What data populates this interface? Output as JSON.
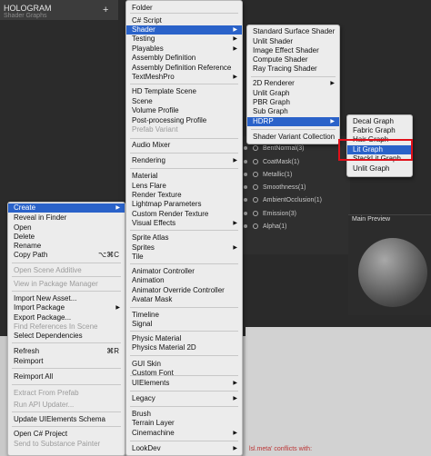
{
  "window": {
    "title": "HOLOGRAM",
    "subtitle": "Shader Graphs",
    "plus": "+"
  },
  "left_menu": {
    "items": [
      {
        "label": "Create",
        "arrow": "▶",
        "selected": true
      },
      {
        "label": "Reveal in Finder"
      },
      {
        "label": "Open"
      },
      {
        "label": "Delete"
      },
      {
        "label": "Rename"
      },
      {
        "label": "Copy Path",
        "shortcut": "⌥⌘C"
      },
      {
        "label": "Open Scene Additive",
        "disabled": true
      },
      {
        "label": "View in Package Manager",
        "disabled": true
      },
      {
        "label": "Import New Asset..."
      },
      {
        "label": "Import Package",
        "arrow": "▶"
      },
      {
        "label": "Export Package..."
      },
      {
        "label": "Find References In Scene",
        "disabled": true
      },
      {
        "label": "Select Dependencies"
      },
      {
        "label": "Refresh",
        "shortcut": "⌘R"
      },
      {
        "label": "Reimport"
      },
      {
        "label": "Reimport All"
      },
      {
        "label": "Extract From Prefab",
        "disabled": true
      },
      {
        "label": "Run API Updater...",
        "disabled": true
      },
      {
        "label": "Update UIElements Schema"
      },
      {
        "label": "Open C# Project"
      },
      {
        "label": "Send to Substance Painter",
        "disabled": true
      }
    ]
  },
  "create_menu": {
    "items": [
      {
        "label": "Folder"
      },
      {
        "label": "C# Script"
      },
      {
        "label": "Shader",
        "arrow": "▶",
        "selected": true
      },
      {
        "label": "Testing",
        "arrow": "▶"
      },
      {
        "label": "Playables",
        "arrow": "▶"
      },
      {
        "label": "Assembly Definition"
      },
      {
        "label": "Assembly Definition Reference"
      },
      {
        "label": "TextMeshPro",
        "arrow": "▶"
      },
      {
        "label": "HD Template Scene"
      },
      {
        "label": "Scene"
      },
      {
        "label": "Volume Profile"
      },
      {
        "label": "Post-processing Profile"
      },
      {
        "label": "Prefab Variant",
        "disabled": true
      },
      {
        "label": "Audio Mixer"
      },
      {
        "label": "Rendering",
        "arrow": "▶"
      },
      {
        "label": "Material"
      },
      {
        "label": "Lens Flare"
      },
      {
        "label": "Render Texture"
      },
      {
        "label": "Lightmap Parameters"
      },
      {
        "label": "Custom Render Texture"
      },
      {
        "label": "Visual Effects",
        "arrow": "▶"
      },
      {
        "label": "Sprite Atlas"
      },
      {
        "label": "Sprites",
        "arrow": "▶"
      },
      {
        "label": "Tile"
      },
      {
        "label": "Animator Controller"
      },
      {
        "label": "Animation"
      },
      {
        "label": "Animator Override Controller"
      },
      {
        "label": "Avatar Mask"
      },
      {
        "label": "Timeline"
      },
      {
        "label": "Signal"
      },
      {
        "label": "Physic Material"
      },
      {
        "label": "Physics Material 2D"
      },
      {
        "label": "GUI Skin"
      },
      {
        "label": "Custom Font"
      },
      {
        "label": "UIElements",
        "arrow": "▶"
      },
      {
        "label": "Legacy",
        "arrow": "▶"
      },
      {
        "label": "Brush"
      },
      {
        "label": "Terrain Layer"
      },
      {
        "label": "Cinemachine",
        "arrow": "▶"
      },
      {
        "label": "LookDev",
        "arrow": "▶"
      }
    ]
  },
  "shader_menu": {
    "items": [
      {
        "label": "Standard Surface Shader"
      },
      {
        "label": "Unlit Shader"
      },
      {
        "label": "Image Effect Shader"
      },
      {
        "label": "Compute Shader"
      },
      {
        "label": "Ray Tracing Shader"
      },
      {
        "label": "2D Renderer",
        "arrow": "▶"
      },
      {
        "label": "Unlit Graph"
      },
      {
        "label": "PBR Graph"
      },
      {
        "label": "Sub Graph"
      },
      {
        "label": "HDRP",
        "arrow": "▶",
        "selected": true
      },
      {
        "label": "Shader Variant Collection"
      }
    ]
  },
  "hdrp_menu": {
    "items": [
      {
        "label": "Decal Graph"
      },
      {
        "label": "Fabric Graph"
      },
      {
        "label": "Hair Graph"
      },
      {
        "label": "Lit Graph",
        "selected": true
      },
      {
        "label": "StackLit Graph"
      },
      {
        "label": "Unlit Graph"
      }
    ]
  },
  "graph_ports": [
    {
      "label": "BentNormal(3)"
    },
    {
      "label": "CoatMask(1)"
    },
    {
      "label": "Metallic(1)"
    },
    {
      "label": "Smoothness(1)"
    },
    {
      "label": "AmbientOcclusion(1)"
    },
    {
      "label": "Emission(3)"
    },
    {
      "label": "Alpha(1)"
    }
  ],
  "main_preview": {
    "title": "Main Preview"
  },
  "console": {
    "warning": "lsl.meta' conflicts with:"
  },
  "colors": {
    "selection": "#2a62c9",
    "highlight_box": "#e0101a",
    "menu_bg": "#ececec"
  }
}
